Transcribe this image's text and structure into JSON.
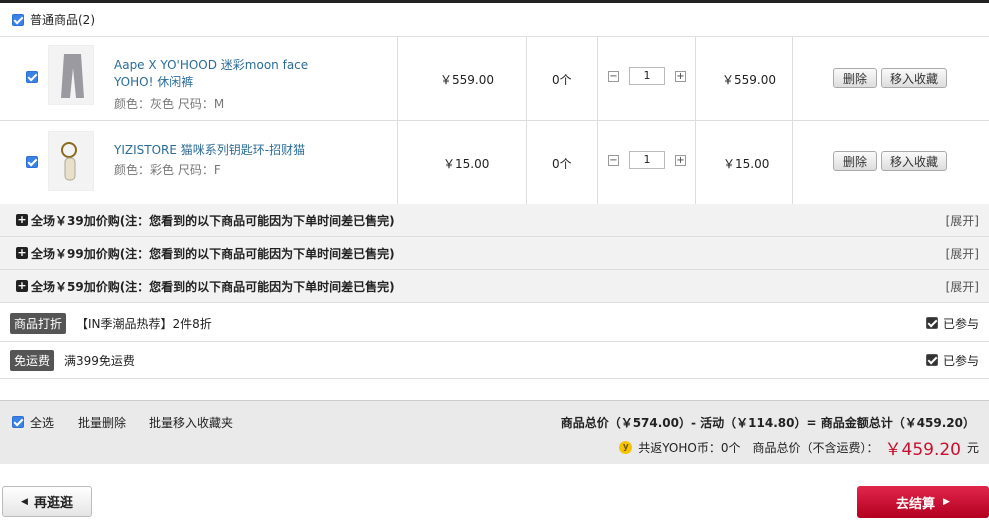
{
  "group": {
    "title": "普通商品(2)"
  },
  "items": [
    {
      "name": "Aape X YO'HOOD 迷彩moon face YOHO! 休闲裤",
      "attrs": "颜色：灰色 尺码：M",
      "price": "￥559.00",
      "count": "0个",
      "qty": "1",
      "subtotal": "￥559.00",
      "delete": "删除",
      "favorite": "移入收藏"
    },
    {
      "name": "YIZISTORE 猫咪系列钥匙环-招财猫",
      "attrs": "颜色：彩色 尺码：F",
      "price": "￥15.00",
      "count": "0个",
      "qty": "1",
      "subtotal": "￥15.00",
      "delete": "删除",
      "favorite": "移入收藏"
    }
  ],
  "addons": [
    {
      "text": "全场￥39加价购(注：您看到的以下商品可能因为下单时间差已售完)",
      "expand": "[展开]"
    },
    {
      "text": "全场￥99加价购(注：您看到的以下商品可能因为下单时间差已售完)",
      "expand": "[展开]"
    },
    {
      "text": "全场￥59加价购(注：您看到的以下商品可能因为下单时间差已售完)",
      "expand": "[展开]"
    }
  ],
  "promos": [
    {
      "tag": "商品打折",
      "text": "【IN季潮品热荐】2件8折",
      "joined": "已参与"
    },
    {
      "tag": "免运费",
      "text": "满399免运费",
      "joined": "已参与"
    }
  ],
  "footer": {
    "select_all": "全选",
    "batch_delete": "批量删除",
    "batch_favorite": "批量移入收藏夹",
    "summary": "商品总价（￥574.00）- 活动（￥114.80）= 商品金额总计（￥459.20）",
    "coin_icon": "y",
    "coins": "共返YOHO币：0个",
    "total_label": "商品总价（不含运费）：",
    "total_value": "￥459.20",
    "total_unit": "元"
  },
  "actions": {
    "back": "再逛逛",
    "checkout": "去结算"
  },
  "colors": {
    "accent": "#c8102e",
    "link": "#2a6c98",
    "checkbox": "#3b82e6"
  }
}
